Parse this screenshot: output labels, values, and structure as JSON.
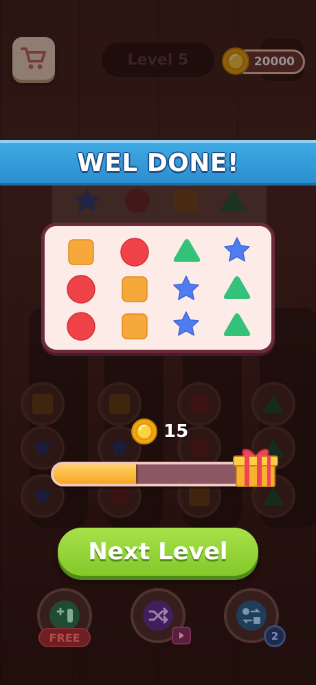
{
  "header": {
    "level_label": "Level 5",
    "coins": "20000"
  },
  "banner": {
    "title": "WEL DONE!"
  },
  "result_grid": {
    "rows": [
      [
        "orange-square",
        "red-circle",
        "green-triangle",
        "blue-star"
      ],
      [
        "red-circle",
        "orange-square",
        "blue-star",
        "green-triangle"
      ],
      [
        "red-circle",
        "orange-square",
        "blue-star",
        "green-triangle"
      ]
    ]
  },
  "reward": {
    "coins": "15",
    "progress": 0.42
  },
  "next_button": {
    "label": "Next Level"
  },
  "boosters": [
    {
      "name": "add-tube",
      "badge": "FREE"
    },
    {
      "name": "shuffle",
      "badge": "video"
    },
    {
      "name": "swap",
      "badge": "2"
    }
  ],
  "colors": {
    "orange": "#f7a83a",
    "red": "#f04349",
    "green": "#34c17a",
    "blue": "#4f7df0",
    "banner": "#2f98d8",
    "button": "#95d43a"
  }
}
